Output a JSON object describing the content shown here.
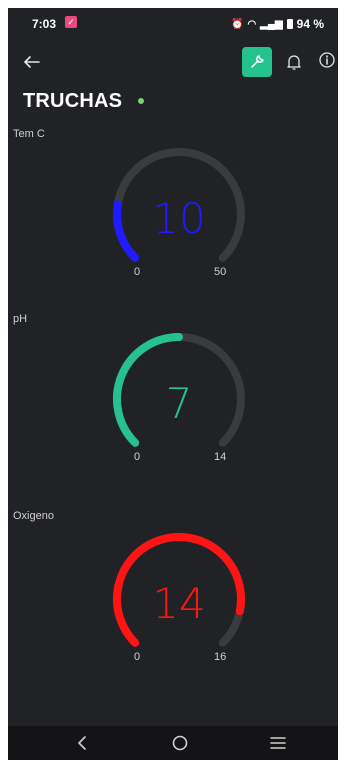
{
  "status_bar": {
    "time": "7:03",
    "battery": "94 %",
    "icons": [
      "alarm-icon",
      "wifi-icon",
      "signal-icon",
      "battery-icon"
    ]
  },
  "toolbar": {
    "back_icon": "arrow-left-icon",
    "wrench_icon": "wrench-icon",
    "bell_icon": "bell-icon",
    "info_icon": "info-icon"
  },
  "device": {
    "name": "TRUCHAS",
    "online": true
  },
  "gauges": [
    {
      "label": "Tem C",
      "value": "10",
      "min": "0",
      "max": "50",
      "value_num": 10,
      "min_num": 0,
      "max_num": 50,
      "color": "#1f1aff"
    },
    {
      "label": "pH",
      "value": "7",
      "min": "0",
      "max": "14",
      "value_num": 7,
      "min_num": 0,
      "max_num": 14,
      "color": "#25c28d"
    },
    {
      "label": "Oxigeno",
      "value": "14",
      "min": "0",
      "max": "16",
      "value_num": 14,
      "min_num": 0,
      "max_num": 16,
      "color": "#ff1414"
    }
  ],
  "colors": {
    "background": "#212225",
    "track": "#3a3b3f",
    "accent": "#25c28d",
    "online": "#7dd36c"
  },
  "nav_bar": {
    "icons": [
      "back-nav-icon",
      "home-nav-icon",
      "recents-nav-icon"
    ]
  }
}
